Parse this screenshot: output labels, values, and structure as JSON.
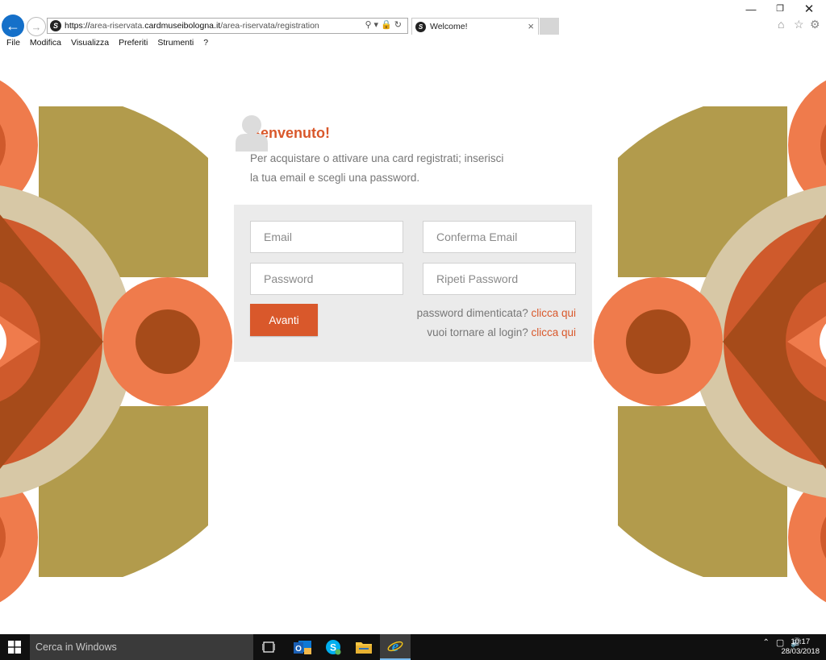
{
  "browser": {
    "url_prefix": "https://",
    "url_pre_domain": "area-riservata.",
    "url_domain": "cardmuseibologna.it",
    "url_path": "/area-riservata/registration",
    "tab_title": "Welcome!",
    "menu": [
      "File",
      "Modifica",
      "Visualizza",
      "Preferiti",
      "Strumenti",
      "?"
    ]
  },
  "page": {
    "heading": "Benvenuto!",
    "intro_line1": "Per acquistare o attivare una card registrati; inserisci",
    "intro_line2": "la tua email e scegli una password.",
    "form": {
      "email_placeholder": "Email",
      "confirm_email_placeholder": "Conferma Email",
      "password_placeholder": "Password",
      "repeat_password_placeholder": "Ripeti Password",
      "submit_label": "Avanti"
    },
    "forgot_text": "password dimenticata? ",
    "forgot_link": "clicca qui",
    "login_text": "vuoi tornare al login? ",
    "login_link": "clicca qui"
  },
  "taskbar": {
    "search_placeholder": "Cerca in Windows",
    "time": "10:17",
    "date": "28/03/2018"
  },
  "colors": {
    "accent": "#d9582b",
    "olive": "#b29b4c",
    "beige": "#d7c8a6",
    "salmon": "#ef7b4c",
    "rust": "#cf5a2c",
    "brown": "#a64b1a"
  }
}
